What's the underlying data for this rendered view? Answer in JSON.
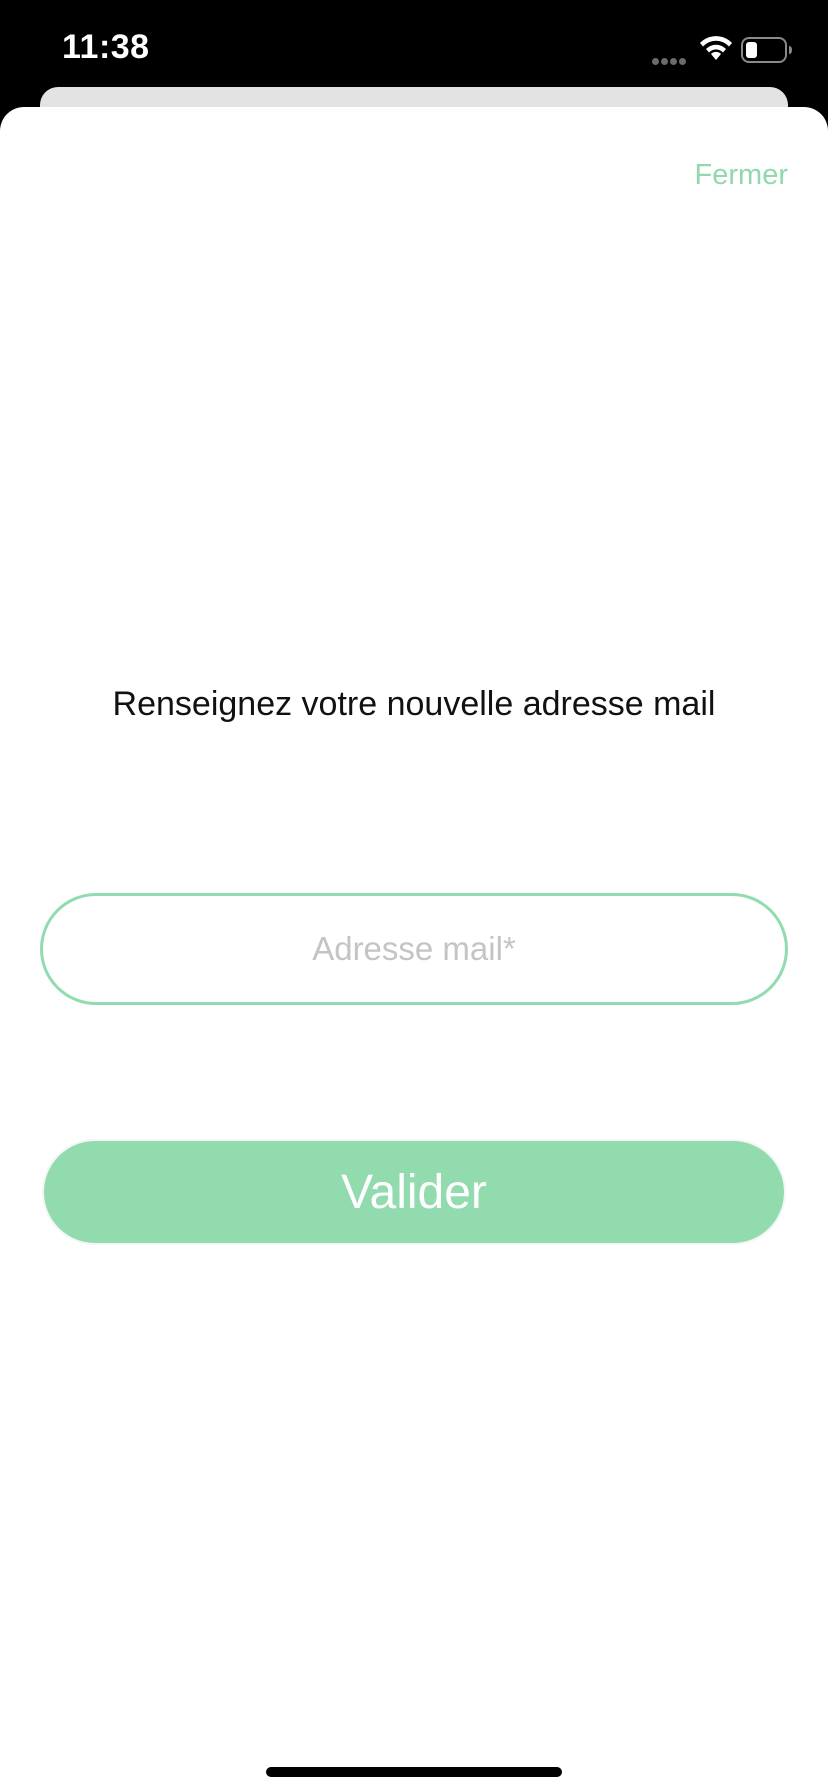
{
  "status_bar": {
    "time": "11:38",
    "icons": [
      "cellular-signal-icon",
      "wifi-icon",
      "battery-icon"
    ]
  },
  "sheet": {
    "close_label": "Fermer",
    "prompt": "Renseignez votre nouvelle adresse mail",
    "email_field": {
      "value": "",
      "placeholder": "Adresse mail*"
    },
    "submit_label": "Valider"
  },
  "colors": {
    "accent": "#92dbaf",
    "accent_text": "#8fd9ac",
    "placeholder": "#c4c4c6",
    "background": "#ffffff",
    "status_bar": "#000000"
  }
}
